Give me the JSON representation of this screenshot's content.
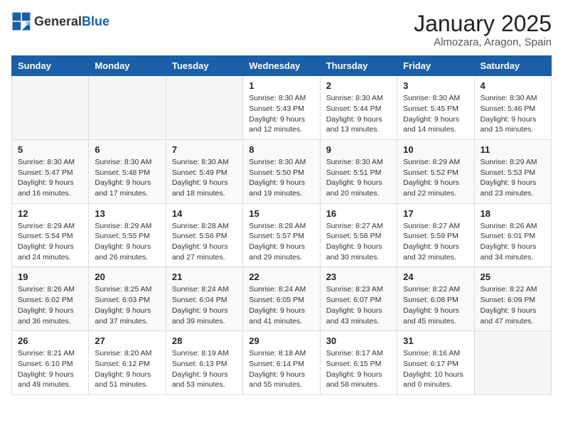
{
  "header": {
    "logo_general": "General",
    "logo_blue": "Blue",
    "month": "January 2025",
    "location": "Almozara, Aragon, Spain"
  },
  "days_of_week": [
    "Sunday",
    "Monday",
    "Tuesday",
    "Wednesday",
    "Thursday",
    "Friday",
    "Saturday"
  ],
  "weeks": [
    [
      {
        "day": "",
        "sunrise": "",
        "sunset": "",
        "daylight": ""
      },
      {
        "day": "",
        "sunrise": "",
        "sunset": "",
        "daylight": ""
      },
      {
        "day": "",
        "sunrise": "",
        "sunset": "",
        "daylight": ""
      },
      {
        "day": "1",
        "sunrise": "Sunrise: 8:30 AM",
        "sunset": "Sunset: 5:43 PM",
        "daylight": "Daylight: 9 hours and 12 minutes."
      },
      {
        "day": "2",
        "sunrise": "Sunrise: 8:30 AM",
        "sunset": "Sunset: 5:44 PM",
        "daylight": "Daylight: 9 hours and 13 minutes."
      },
      {
        "day": "3",
        "sunrise": "Sunrise: 8:30 AM",
        "sunset": "Sunset: 5:45 PM",
        "daylight": "Daylight: 9 hours and 14 minutes."
      },
      {
        "day": "4",
        "sunrise": "Sunrise: 8:30 AM",
        "sunset": "Sunset: 5:46 PM",
        "daylight": "Daylight: 9 hours and 15 minutes."
      }
    ],
    [
      {
        "day": "5",
        "sunrise": "Sunrise: 8:30 AM",
        "sunset": "Sunset: 5:47 PM",
        "daylight": "Daylight: 9 hours and 16 minutes."
      },
      {
        "day": "6",
        "sunrise": "Sunrise: 8:30 AM",
        "sunset": "Sunset: 5:48 PM",
        "daylight": "Daylight: 9 hours and 17 minutes."
      },
      {
        "day": "7",
        "sunrise": "Sunrise: 8:30 AM",
        "sunset": "Sunset: 5:49 PM",
        "daylight": "Daylight: 9 hours and 18 minutes."
      },
      {
        "day": "8",
        "sunrise": "Sunrise: 8:30 AM",
        "sunset": "Sunset: 5:50 PM",
        "daylight": "Daylight: 9 hours and 19 minutes."
      },
      {
        "day": "9",
        "sunrise": "Sunrise: 8:30 AM",
        "sunset": "Sunset: 5:51 PM",
        "daylight": "Daylight: 9 hours and 20 minutes."
      },
      {
        "day": "10",
        "sunrise": "Sunrise: 8:29 AM",
        "sunset": "Sunset: 5:52 PM",
        "daylight": "Daylight: 9 hours and 22 minutes."
      },
      {
        "day": "11",
        "sunrise": "Sunrise: 8:29 AM",
        "sunset": "Sunset: 5:53 PM",
        "daylight": "Daylight: 9 hours and 23 minutes."
      }
    ],
    [
      {
        "day": "12",
        "sunrise": "Sunrise: 8:29 AM",
        "sunset": "Sunset: 5:54 PM",
        "daylight": "Daylight: 9 hours and 24 minutes."
      },
      {
        "day": "13",
        "sunrise": "Sunrise: 8:29 AM",
        "sunset": "Sunset: 5:55 PM",
        "daylight": "Daylight: 9 hours and 26 minutes."
      },
      {
        "day": "14",
        "sunrise": "Sunrise: 8:28 AM",
        "sunset": "Sunset: 5:56 PM",
        "daylight": "Daylight: 9 hours and 27 minutes."
      },
      {
        "day": "15",
        "sunrise": "Sunrise: 8:28 AM",
        "sunset": "Sunset: 5:57 PM",
        "daylight": "Daylight: 9 hours and 29 minutes."
      },
      {
        "day": "16",
        "sunrise": "Sunrise: 8:27 AM",
        "sunset": "Sunset: 5:58 PM",
        "daylight": "Daylight: 9 hours and 30 minutes."
      },
      {
        "day": "17",
        "sunrise": "Sunrise: 8:27 AM",
        "sunset": "Sunset: 5:59 PM",
        "daylight": "Daylight: 9 hours and 32 minutes."
      },
      {
        "day": "18",
        "sunrise": "Sunrise: 8:26 AM",
        "sunset": "Sunset: 6:01 PM",
        "daylight": "Daylight: 9 hours and 34 minutes."
      }
    ],
    [
      {
        "day": "19",
        "sunrise": "Sunrise: 8:26 AM",
        "sunset": "Sunset: 6:02 PM",
        "daylight": "Daylight: 9 hours and 36 minutes."
      },
      {
        "day": "20",
        "sunrise": "Sunrise: 8:25 AM",
        "sunset": "Sunset: 6:03 PM",
        "daylight": "Daylight: 9 hours and 37 minutes."
      },
      {
        "day": "21",
        "sunrise": "Sunrise: 8:24 AM",
        "sunset": "Sunset: 6:04 PM",
        "daylight": "Daylight: 9 hours and 39 minutes."
      },
      {
        "day": "22",
        "sunrise": "Sunrise: 8:24 AM",
        "sunset": "Sunset: 6:05 PM",
        "daylight": "Daylight: 9 hours and 41 minutes."
      },
      {
        "day": "23",
        "sunrise": "Sunrise: 8:23 AM",
        "sunset": "Sunset: 6:07 PM",
        "daylight": "Daylight: 9 hours and 43 minutes."
      },
      {
        "day": "24",
        "sunrise": "Sunrise: 8:22 AM",
        "sunset": "Sunset: 6:08 PM",
        "daylight": "Daylight: 9 hours and 45 minutes."
      },
      {
        "day": "25",
        "sunrise": "Sunrise: 8:22 AM",
        "sunset": "Sunset: 6:09 PM",
        "daylight": "Daylight: 9 hours and 47 minutes."
      }
    ],
    [
      {
        "day": "26",
        "sunrise": "Sunrise: 8:21 AM",
        "sunset": "Sunset: 6:10 PM",
        "daylight": "Daylight: 9 hours and 49 minutes."
      },
      {
        "day": "27",
        "sunrise": "Sunrise: 8:20 AM",
        "sunset": "Sunset: 6:12 PM",
        "daylight": "Daylight: 9 hours and 51 minutes."
      },
      {
        "day": "28",
        "sunrise": "Sunrise: 8:19 AM",
        "sunset": "Sunset: 6:13 PM",
        "daylight": "Daylight: 9 hours and 53 minutes."
      },
      {
        "day": "29",
        "sunrise": "Sunrise: 8:18 AM",
        "sunset": "Sunset: 6:14 PM",
        "daylight": "Daylight: 9 hours and 55 minutes."
      },
      {
        "day": "30",
        "sunrise": "Sunrise: 8:17 AM",
        "sunset": "Sunset: 6:15 PM",
        "daylight": "Daylight: 9 hours and 58 minutes."
      },
      {
        "day": "31",
        "sunrise": "Sunrise: 8:16 AM",
        "sunset": "Sunset: 6:17 PM",
        "daylight": "Daylight: 10 hours and 0 minutes."
      },
      {
        "day": "",
        "sunrise": "",
        "sunset": "",
        "daylight": ""
      }
    ]
  ]
}
